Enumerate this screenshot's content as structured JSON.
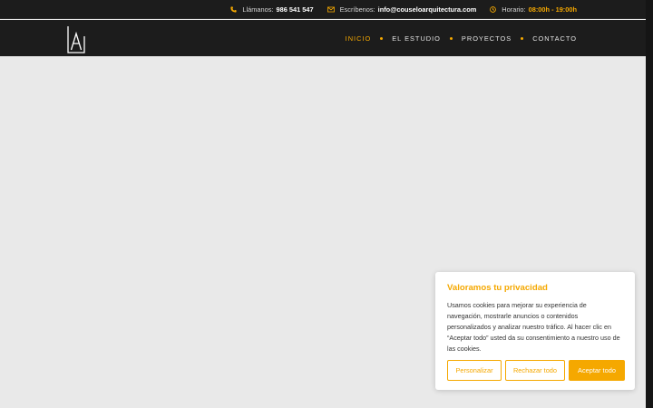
{
  "topbar": {
    "phone_label": "Llámanos:",
    "phone_value": "986 541 547",
    "email_label": "Escríbenos:",
    "email_value": "info@couseloarquitectura.com",
    "hours_label": "Horario:",
    "hours_value": "08:00h - 19:00h",
    "icons": [
      "phone-icon",
      "envelope-icon",
      "clock-icon"
    ]
  },
  "header": {
    "nav": [
      {
        "label": "INICIO",
        "active": true
      },
      {
        "label": "EL ESTUDIO",
        "active": false
      },
      {
        "label": "PROYECTOS",
        "active": false
      },
      {
        "label": "CONTACTO",
        "active": false
      }
    ]
  },
  "cookie": {
    "title": "Valoramos tu privacidad",
    "text": "Usamos cookies para mejorar su experiencia de navegación, mostrarle anuncios o contenidos personalizados y analizar nuestro tráfico. Al hacer clic en “Aceptar todo” usted da su consentimiento a nuestro uso de las cookies.",
    "customize_label": "Personalizar",
    "reject_label": "Rechazar todo",
    "accept_label": "Aceptar todo"
  },
  "colors": {
    "accent": "#f5a800",
    "header_bg": "#1c1c1c",
    "page_bg": "#e9e9e9"
  }
}
